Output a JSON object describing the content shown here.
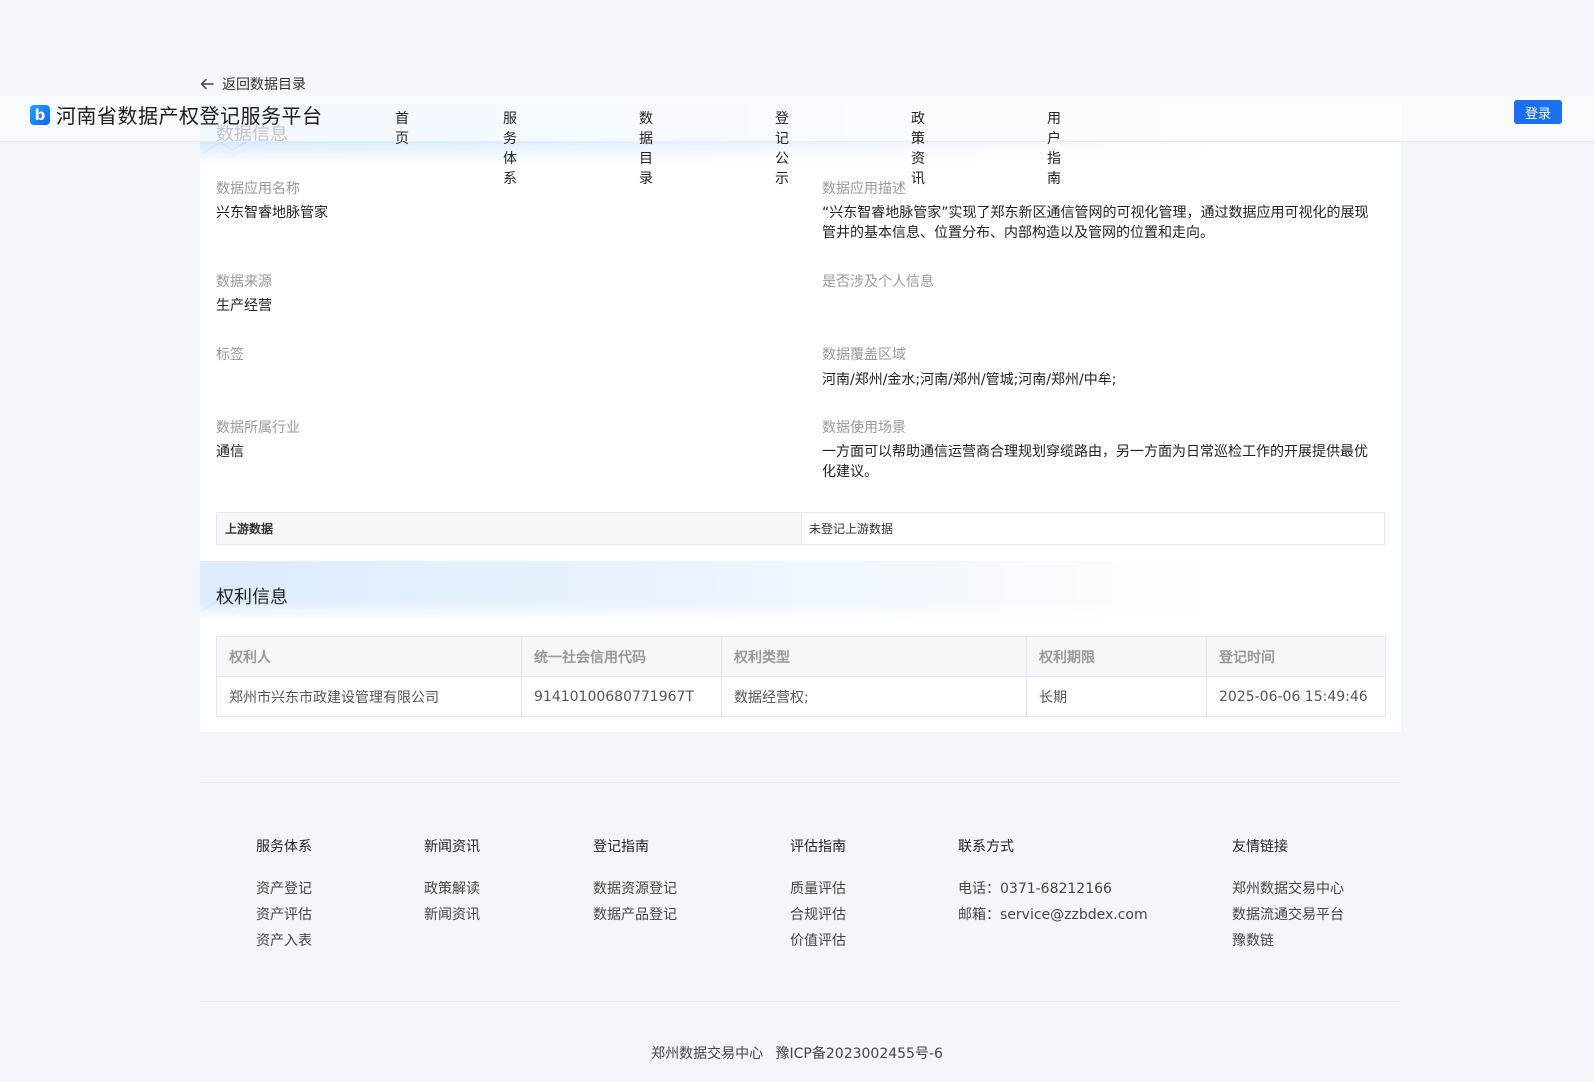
{
  "back_link": {
    "label": "返回数据目录"
  },
  "header": {
    "logo_mark": "b",
    "site_title": "河南省数据产权登记服务平台",
    "nav": [
      "首页",
      "服务体系",
      "数据目录",
      "登记公示",
      "政策资讯",
      "用户指南"
    ],
    "login_label": "登录"
  },
  "data_info": {
    "title": "数据信息",
    "fields": [
      {
        "label": "数据应用名称",
        "value": "兴东智睿地脉管家"
      },
      {
        "label": "数据应用描述",
        "value": "“兴东智睿地脉管家”实现了郑东新区通信管网的可视化管理，通过数据应用可视化的展现管井的基本信息、位置分布、内部构造以及管网的位置和走向。"
      },
      {
        "label": "数据来源",
        "value": "生产经营"
      },
      {
        "label": "是否涉及个人信息",
        "value": ""
      },
      {
        "label": "标签",
        "value": ""
      },
      {
        "label": "数据覆盖区域",
        "value": "河南/郑州/金水;河南/郑州/管城;河南/郑州/中牟;"
      },
      {
        "label": "数据所属行业",
        "value": "通信"
      },
      {
        "label": "数据使用场景",
        "value": "一方面可以帮助通信运营商合理规划穿缆路由，另一方面为日常巡检工作的开展提供最优化建议。"
      }
    ],
    "upstream": {
      "label": "上游数据",
      "value": "未登记上游数据"
    }
  },
  "rights_info": {
    "title": "权利信息",
    "columns": [
      "权利人",
      "统一社会信用代码",
      "权利类型",
      "权利期限",
      "登记时间"
    ],
    "rows": [
      [
        "郑州市兴东市政建设管理有限公司",
        "91410100680771967T",
        "数据经营权;",
        "长期",
        "2025-06-06 15:49:46"
      ]
    ]
  },
  "footer": {
    "columns": [
      {
        "heading": "服务体系",
        "links": [
          "资产登记",
          "资产评估",
          "资产入表"
        ]
      },
      {
        "heading": "新闻资讯",
        "links": [
          "政策解读",
          "新闻资讯"
        ]
      },
      {
        "heading": "登记指南",
        "links": [
          "数据资源登记",
          "数据产品登记"
        ]
      },
      {
        "heading": "评估指南",
        "links": [
          "质量评估",
          "合规评估",
          "价值评估"
        ]
      },
      {
        "heading": "联系方式",
        "links": [
          "电话：0371-68212166",
          "邮箱：service@zzbdex.com"
        ]
      },
      {
        "heading": "友情链接",
        "links": [
          "郑州数据交易中心",
          "数据流通交易平台",
          "豫数链"
        ]
      }
    ],
    "copyright": {
      "org": "郑州数据交易中心",
      "icp": "豫ICP备2023002455号-6"
    }
  },
  "colors": {
    "primary": "#1d6ff2",
    "label_gray": "#999999",
    "background": "#f3f6fb"
  }
}
